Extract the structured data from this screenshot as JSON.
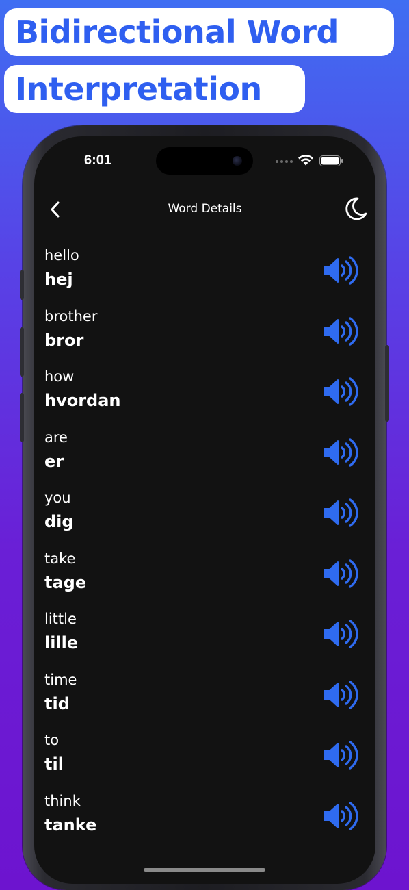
{
  "headline": {
    "line1": "Bidirectional Word",
    "line2": "Interpretation"
  },
  "status_bar": {
    "time": "6:01",
    "icons": [
      "signal-dots-icon",
      "wifi-icon",
      "battery-icon"
    ]
  },
  "nav": {
    "title": "Word Details",
    "back_icon": "chevron-left-icon",
    "theme_icon": "moon-icon"
  },
  "colors": {
    "accent": "#2f6bf0",
    "screen_bg": "#121212",
    "text": "#ffffff"
  },
  "words": [
    {
      "source": "hello",
      "target": "hej"
    },
    {
      "source": "brother",
      "target": "bror"
    },
    {
      "source": "how",
      "target": "hvordan"
    },
    {
      "source": "are",
      "target": "er"
    },
    {
      "source": "you",
      "target": "dig"
    },
    {
      "source": "take",
      "target": "tage"
    },
    {
      "source": "little",
      "target": "lille"
    },
    {
      "source": "time",
      "target": "tid"
    },
    {
      "source": "to",
      "target": "til"
    },
    {
      "source": "think",
      "target": "tanke"
    }
  ]
}
